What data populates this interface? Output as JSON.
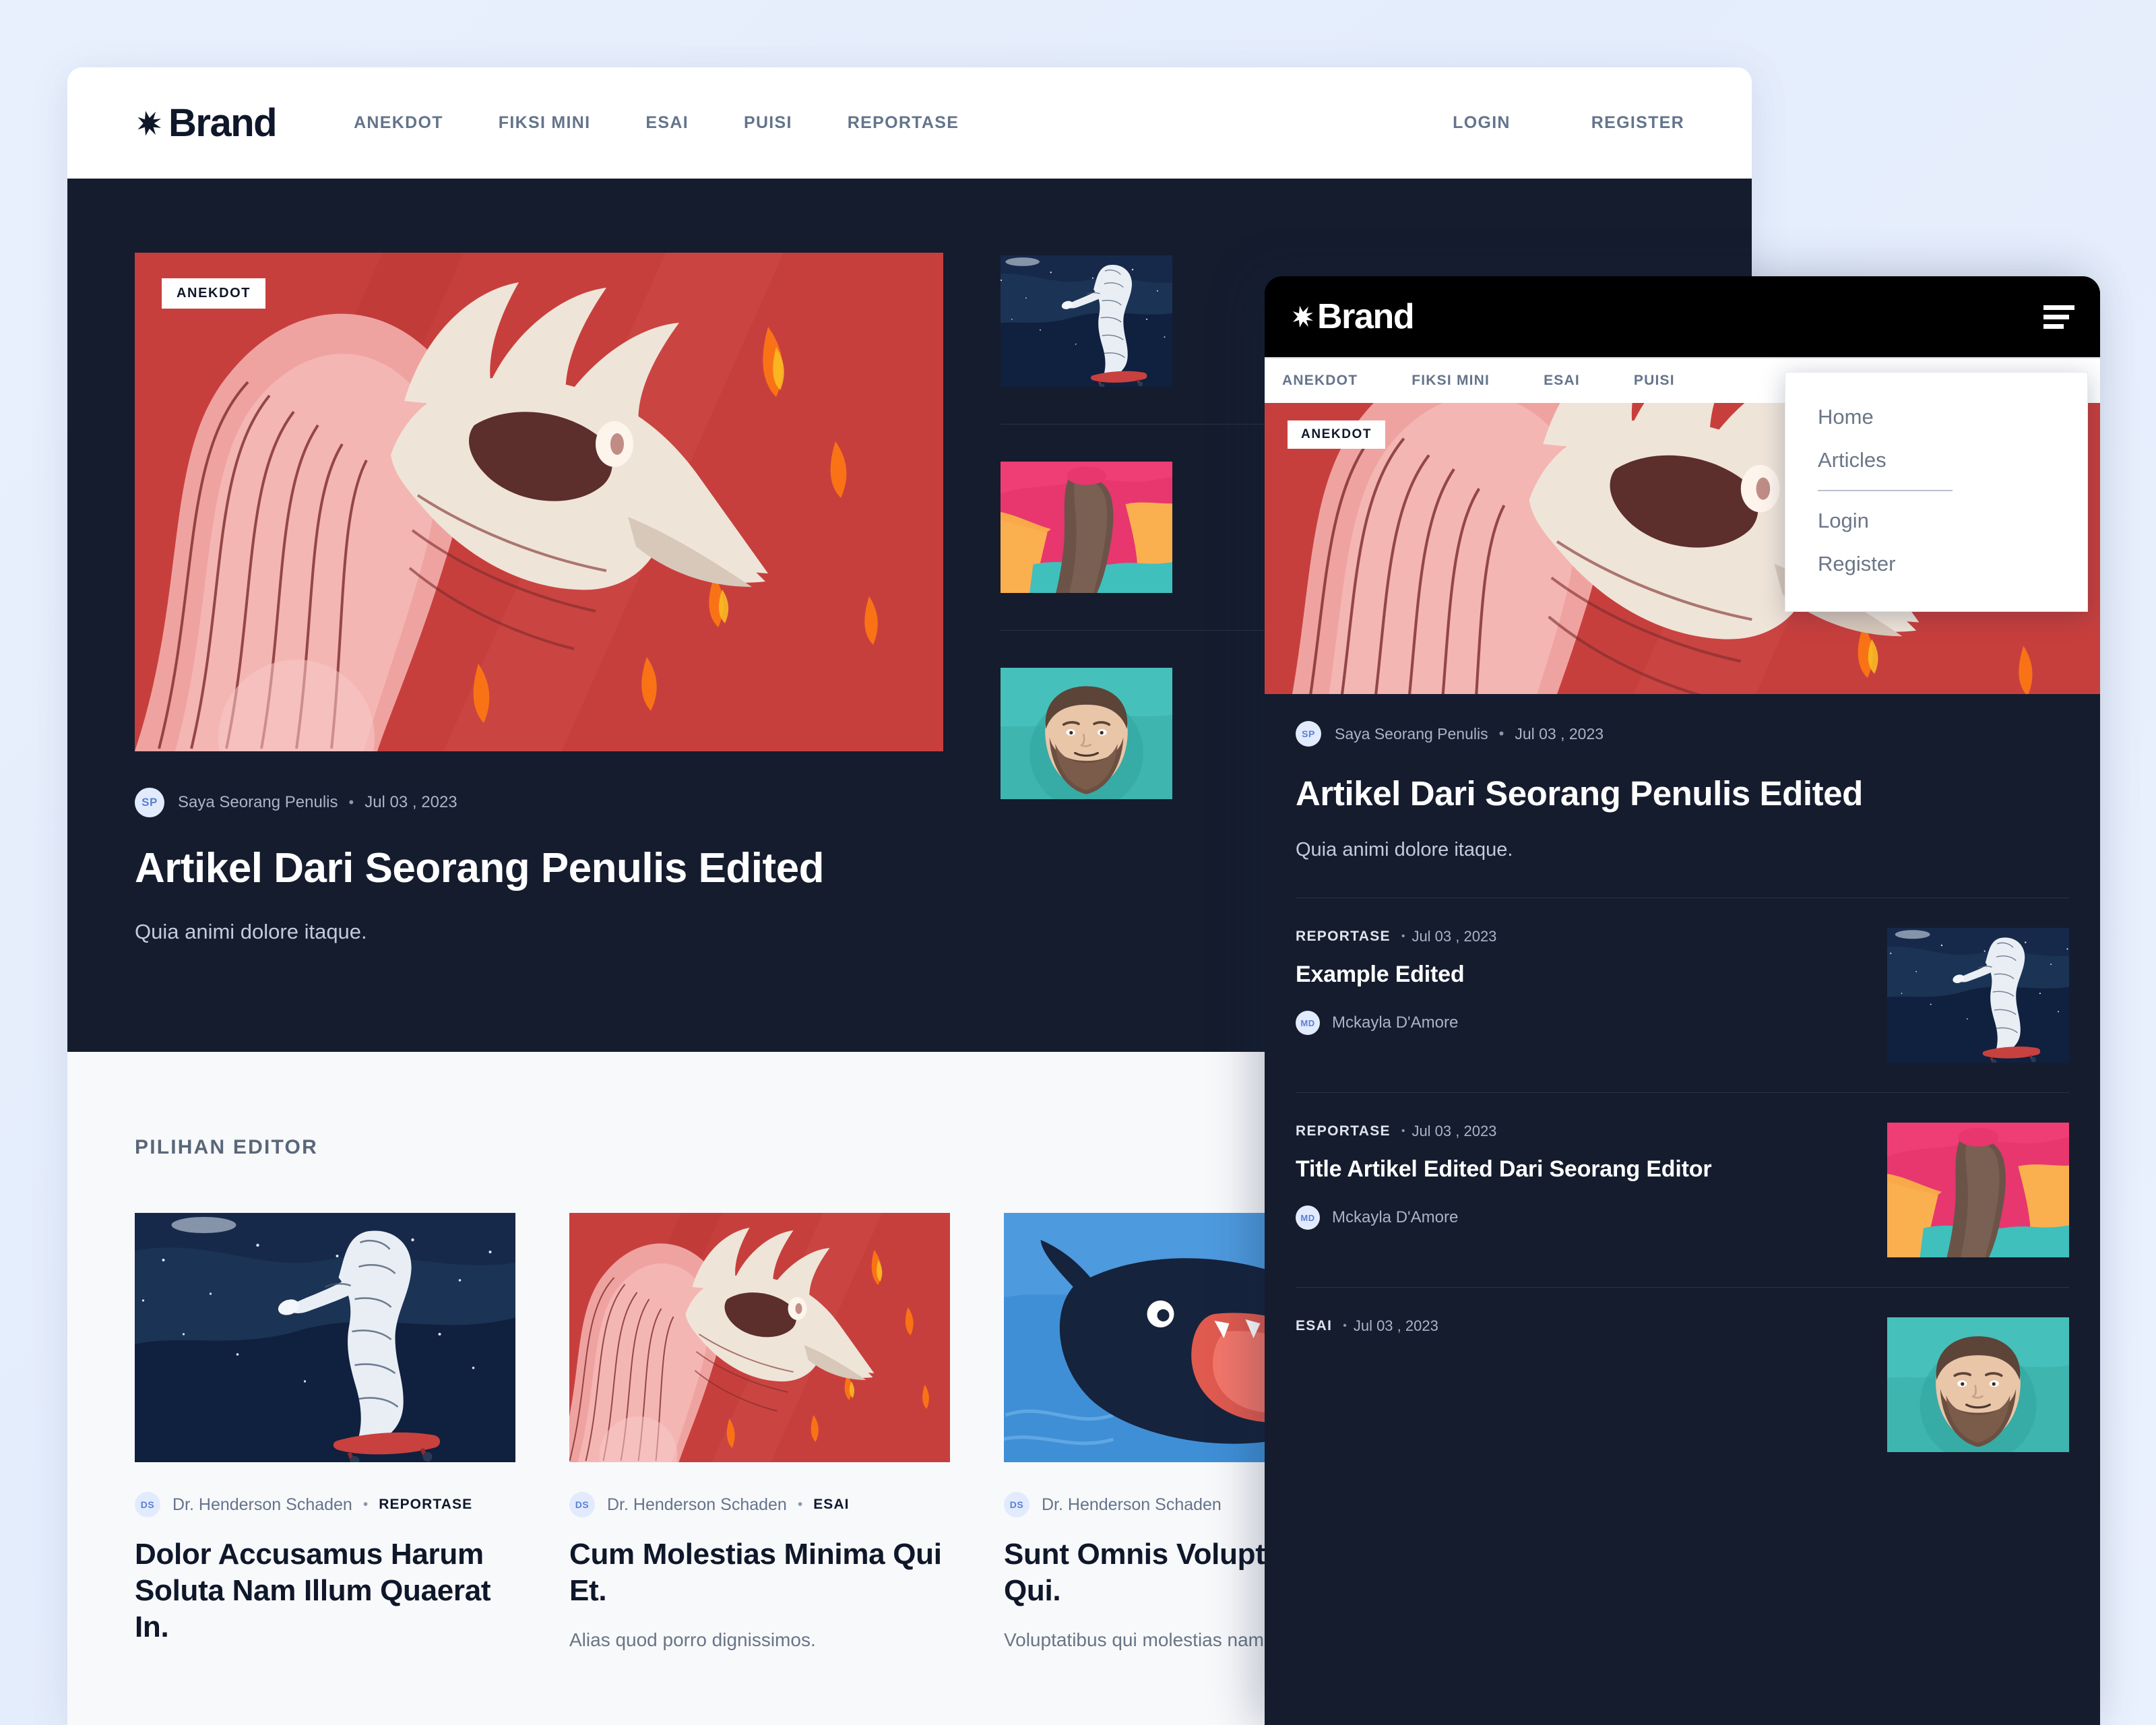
{
  "brand": {
    "name": "Brand",
    "logo_icon": "star-burst-icon"
  },
  "desktop": {
    "nav": [
      {
        "label": "ANEKDOT"
      },
      {
        "label": "FIKSI MINI"
      },
      {
        "label": "ESAI"
      },
      {
        "label": "PUISI"
      },
      {
        "label": "REPORTASE"
      }
    ],
    "auth": [
      {
        "label": "LOGIN"
      },
      {
        "label": "REGISTER"
      }
    ],
    "hero": {
      "badge": "ANEKDOT",
      "author_initials": "SP",
      "author": "Saya Seorang Penulis",
      "separator": "•",
      "date": "Jul 03 , 2023",
      "title": "Artikel Dari Seorang Penulis Edited",
      "subtitle": "Quia animi dolore itaque."
    },
    "side_items": [
      {
        "art": "astronaut"
      },
      {
        "art": "abstract"
      },
      {
        "art": "beard"
      }
    ],
    "editors": {
      "section_title": "PILIHAN EDITOR",
      "cards": [
        {
          "art": "astronaut",
          "author_initials": "DS",
          "author": "Dr. Henderson Schaden",
          "separator": "•",
          "category": "REPORTASE",
          "title": "Dolor Accusamus Harum Soluta Nam Illum Quaerat In.",
          "excerpt": ""
        },
        {
          "art": "bird",
          "author_initials": "DS",
          "author": "Dr. Henderson Schaden",
          "separator": "•",
          "category": "ESAI",
          "title": "Cum Molestias Minima Qui Et.",
          "excerpt": "Alias quod porro dignissimos."
        },
        {
          "art": "whale",
          "author_initials": "DS",
          "author": "Dr. Henderson Schaden",
          "separator": "•",
          "category": "",
          "title": "Sunt Omnis Voluptatem Qui.",
          "excerpt": "Voluptatibus qui molestias nam."
        }
      ]
    }
  },
  "mobile": {
    "nav": [
      {
        "label": "ANEKDOT"
      },
      {
        "label": "FIKSI MINI"
      },
      {
        "label": "ESAI"
      },
      {
        "label": "PUISI"
      }
    ],
    "menu_icon": "hamburger-icon",
    "dropdown": [
      {
        "label": "Home"
      },
      {
        "label": "Articles"
      },
      {
        "label": "Login"
      },
      {
        "label": "Register"
      }
    ],
    "hero": {
      "badge": "ANEKDOT",
      "author_initials": "SP",
      "author": "Saya Seorang Penulis",
      "separator": "•",
      "date": "Jul 03 , 2023",
      "title": "Artikel Dari Seorang Penulis Edited",
      "subtitle": "Quia animi dolore itaque."
    },
    "list": [
      {
        "category": "REPORTASE",
        "separator": "•",
        "date": "Jul 03 , 2023",
        "title": "Example Edited",
        "author_initials": "MD",
        "author": "Mckayla D'Amore",
        "art": "astronaut"
      },
      {
        "category": "REPORTASE",
        "separator": "•",
        "date": "Jul 03 , 2023",
        "title": "Title Artikel Edited Dari Seorang Editor",
        "author_initials": "MD",
        "author": "Mckayla D'Amore",
        "art": "abstract"
      },
      {
        "category": "ESAI",
        "separator": "•",
        "date": "Jul 03 , 2023",
        "title": "",
        "author_initials": "",
        "author": "",
        "art": "beard"
      }
    ]
  },
  "colors": {
    "page_bg": "#e9f0fd",
    "dark_navy": "#151c2e",
    "header_black": "#000000",
    "muted_text": "#64748b",
    "avatar_bg": "#e2ebfd",
    "avatar_text": "#5b7fd4",
    "red_art": "#c8413f",
    "blue_art": "#152a4e",
    "teal_art": "#3fb5b0"
  }
}
